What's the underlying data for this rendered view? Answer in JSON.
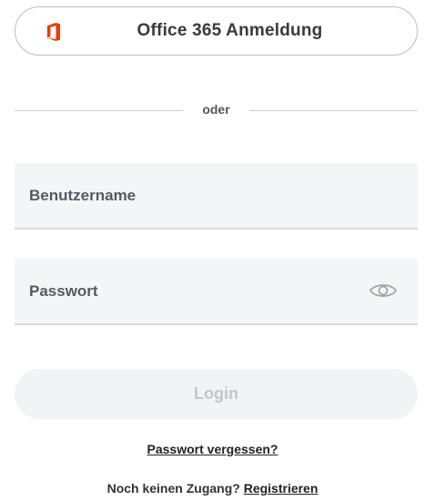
{
  "office_login": {
    "label": "Office 365 Anmeldung",
    "icon": "office-logo-icon",
    "icon_color": "#eb3c00"
  },
  "divider": {
    "label": "oder"
  },
  "username": {
    "placeholder": "Benutzername",
    "value": ""
  },
  "password": {
    "placeholder": "Passwort",
    "value": "",
    "toggle_icon": "eye-icon"
  },
  "login_button": {
    "label": "Login"
  },
  "forgot_password": {
    "label": "Passwort vergessen?"
  },
  "register": {
    "prompt": "Noch keinen Zugang?",
    "link_label": "Registrieren"
  }
}
